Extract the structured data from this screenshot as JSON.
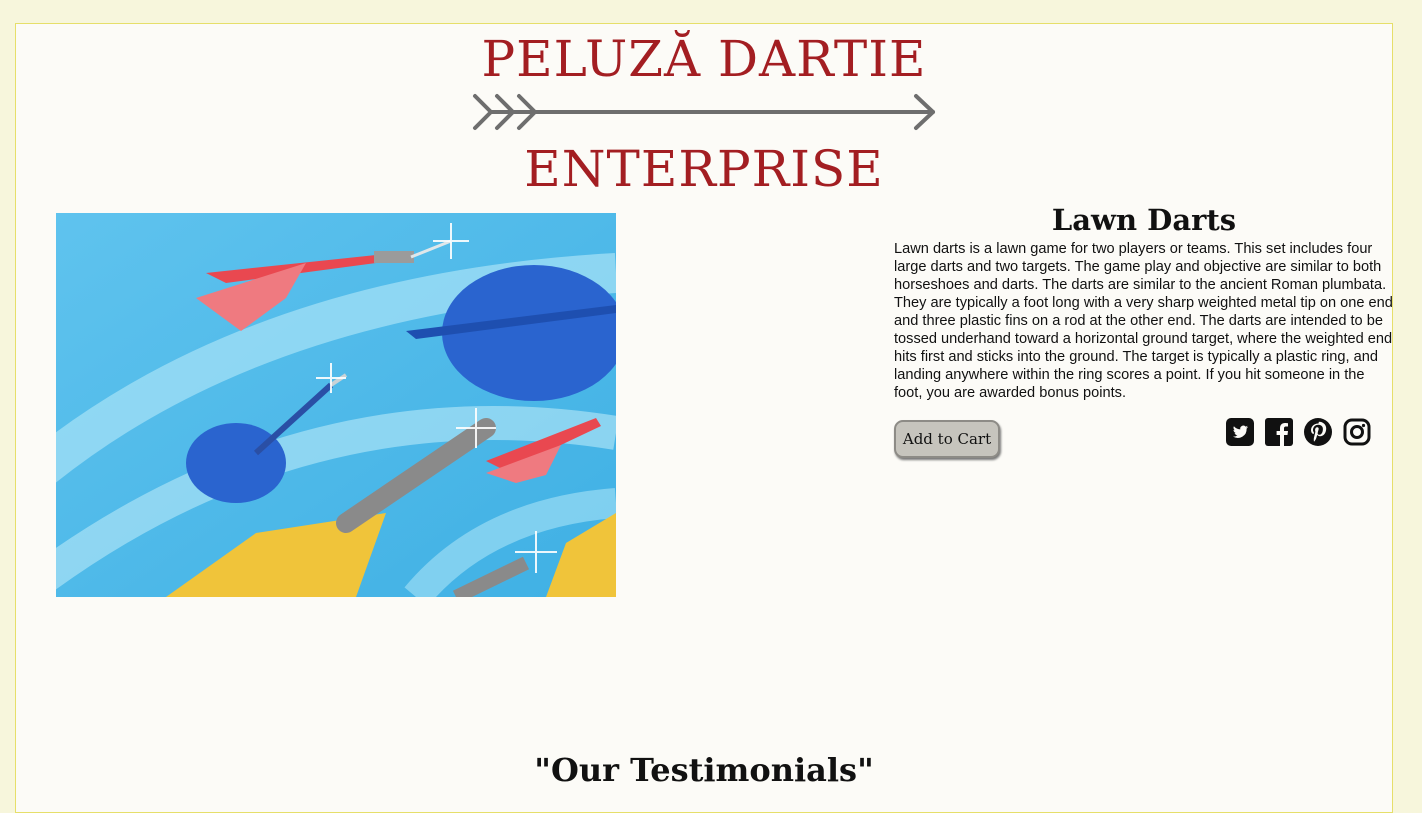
{
  "header": {
    "brand_line1": "PELUZĂ DARTIE",
    "brand_line2": "ENTERPRISE"
  },
  "product": {
    "title": "Lawn Darts",
    "description": "Lawn darts is a lawn game for two players or teams. This set includes four large darts and two targets. The game play and objective are similar to both horseshoes and darts. The darts are similar to the ancient Roman plumbata. They are typically a foot long with a very sharp weighted metal tip on one end and three plastic fins on a rod at the other end. The darts are intended to be tossed underhand toward a horizontal ground target, where the weighted end hits first and sticks into the ground. The target is typically a plastic ring, and landing anywhere within the ring scores a point. If you hit someone in the foot, you are awarded bonus points.",
    "add_to_cart_label": "Add to Cart"
  },
  "social_icons": [
    "twitter-icon",
    "facebook-icon",
    "pinterest-icon",
    "instagram-icon"
  ],
  "testimonials": {
    "heading": "\"Our Testimonials\""
  },
  "colors": {
    "brand_red": "#a31e22",
    "page_bg": "#fcfbf7",
    "outer_bg": "#f7f6dc",
    "border_yellow": "#e6df6a"
  }
}
